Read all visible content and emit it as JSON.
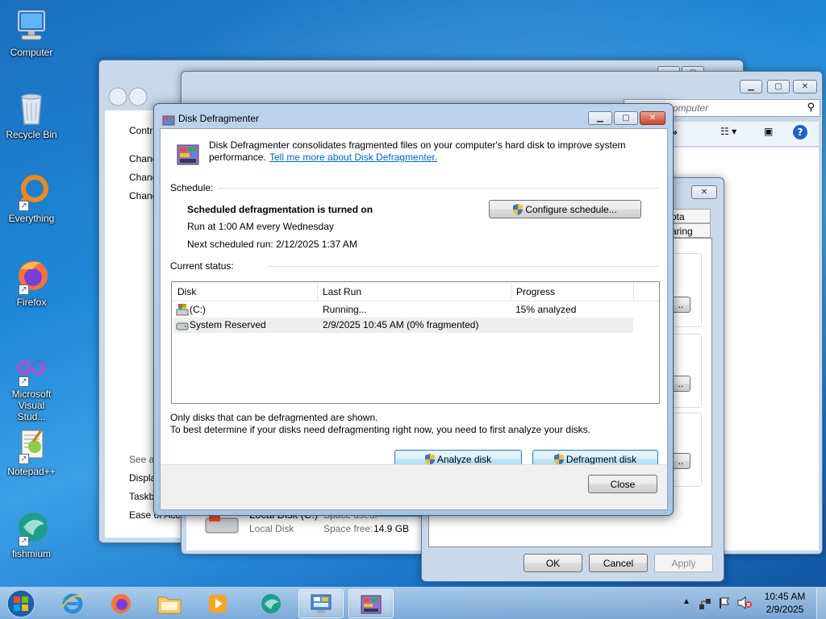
{
  "desktop": {
    "icons": [
      {
        "label": "Computer"
      },
      {
        "label": "Recycle Bin"
      },
      {
        "label": "Everything"
      },
      {
        "label": "Firefox"
      },
      {
        "label": "Microsoft Visual Stud..."
      },
      {
        "label": "Notepad++"
      },
      {
        "label": "fishmium"
      }
    ]
  },
  "control_panel_window": {
    "partial_texts": [
      "Contr",
      "Chang",
      "Chang",
      "Chang",
      "See al",
      "Displa",
      "Taskb",
      "Ease of Acce"
    ]
  },
  "explorer_window": {
    "search_placeholder": "omputer",
    "drive": {
      "name": "Local Disk (C:)",
      "type": "Local Disk",
      "space_used_label": "Space used:",
      "space_free_label": "Space free:",
      "space_free_value": "14.9 GB"
    }
  },
  "properties_dialog": {
    "tabs": [
      "ota",
      "aring"
    ],
    "ok_label": "OK",
    "cancel_label": "Cancel",
    "apply_label": "Apply"
  },
  "defrag": {
    "title": "Disk Defragmenter",
    "intro_text": "Disk Defragmenter consolidates fragmented files on your computer's hard disk to improve system",
    "intro_text2": "performance.",
    "learn_more_link": "Tell me more about Disk Defragmenter.",
    "schedule_label": "Schedule:",
    "schedule_status": "Scheduled defragmentation is turned on",
    "schedule_run": "Run at 1:00 AM every Wednesday",
    "next_run": "Next scheduled run: 2/12/2025 1:37 AM",
    "configure_label": "Configure schedule...",
    "current_status_label": "Current status:",
    "columns": [
      "Disk",
      "Last Run",
      "Progress"
    ],
    "disks": [
      {
        "name": "(C:)",
        "last_run": "Running...",
        "progress": "15% analyzed"
      },
      {
        "name": "System Reserved",
        "last_run": "2/9/2025 10:45 AM (0% fragmented)",
        "progress": ""
      }
    ],
    "note1": "Only disks that can be defragmented are shown.",
    "note2": "To best determine if your disks need defragmenting right now, you need to first analyze your disks.",
    "analyze_label": "Analyze disk",
    "defragment_label": "Defragment disk",
    "close_label": "Close"
  },
  "taskbar": {
    "time": "10:45 AM",
    "date": "2/9/2025"
  }
}
